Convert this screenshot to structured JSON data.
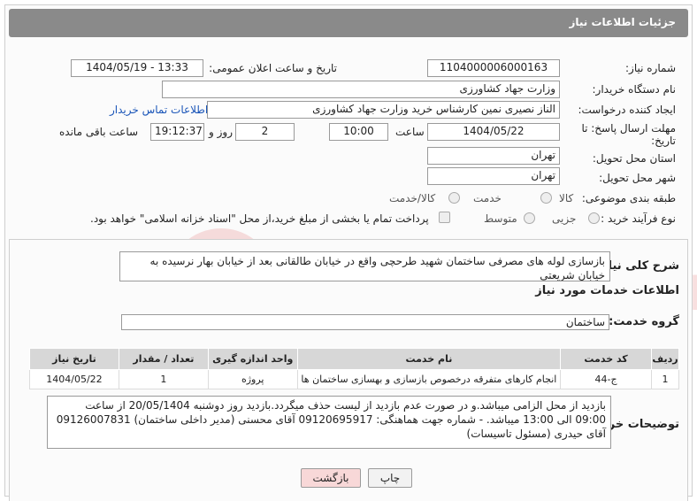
{
  "header": {
    "title": "جزئیات اطلاعات نیاز"
  },
  "fields": {
    "need_number_label": "شماره نیاز:",
    "need_number": "1104000006000163",
    "announce_label": "تاریخ و ساعت اعلان عمومی:",
    "announce_value": "1404/05/19 - 13:33",
    "buyer_org_label": "نام دستگاه خریدار:",
    "buyer_org": "وزارت جهاد کشاورزی",
    "creator_label": "ایجاد کننده درخواست:",
    "creator": "الناز نصیری نمین کارشناس خرید وزارت جهاد کشاورزی",
    "contact_link": "اطلاعات تماس خریدار",
    "deadline_label_1": "مهلت ارسال پاسخ: تا",
    "deadline_label_2": "تاریخ:",
    "deadline_date": "1404/05/22",
    "time_label": "ساعت",
    "deadline_time": "10:00",
    "days_value": "2",
    "days_label": "روز و",
    "remaining_time": "19:12:37",
    "remaining_label": "ساعت باقی مانده",
    "province_label": "استان محل تحویل:",
    "province": "تهران",
    "city_label": "شهر محل تحویل:",
    "city": "تهران",
    "category_label": "طبقه بندی موضوعی:",
    "category_options": [
      "کالا",
      "خدمت",
      "کالا/خدمت"
    ],
    "process_label": "نوع فرآیند خرید :",
    "process_options": [
      "جزیی",
      "متوسط"
    ],
    "payment_note": "پرداخت تمام یا بخشی از مبلغ خرید،از محل \"اسناد خزانه اسلامی\" خواهد بود."
  },
  "summary": {
    "label": "شرح کلی نیاز:",
    "text": "بازسازی لوله های مصرفی ساختمان شهید طرحچی واقع در خیابان طالقانی بعد از خیابان بهار نرسیده به خیابان شریعتی"
  },
  "services": {
    "title": "اطلاعات خدمات مورد نیاز",
    "group_label": "گروه خدمت:",
    "group_value": "ساختمان",
    "columns": [
      "ردیف",
      "کد خدمت",
      "نام خدمت",
      "واحد اندازه گیری",
      "تعداد / مقدار",
      "تاریخ نیاز"
    ],
    "rows": [
      [
        "1",
        "ج-44",
        "انجام کارهای متفرقه درخصوص بازسازی و بهسازی ساختمان ها",
        "پروژه",
        "1",
        "1404/05/22"
      ]
    ]
  },
  "buyer_notes": {
    "label": "توضیحات خریدار:",
    "text": "بازدید از محل الزامی میباشد.و در صورت عدم بازدید از لیست حذف میگردد.بازدید روز دوشنبه 20/05/1404 از ساعت 09:00 الی 13:00  میباشد.  -   شماره جهت هماهنگی: 09120695917 آقای محسنی (مدیر داخلی ساختمان) 09126007831 آقای حیدری (مسئول تاسیسات)"
  },
  "buttons": {
    "print": "چاپ",
    "back": "بازگشت"
  },
  "watermark": "AriaTender.net",
  "colors": {
    "header_bg": "#8a8a8a",
    "link": "#1a55b8",
    "back_btn_bg": "#f8d8d8"
  }
}
